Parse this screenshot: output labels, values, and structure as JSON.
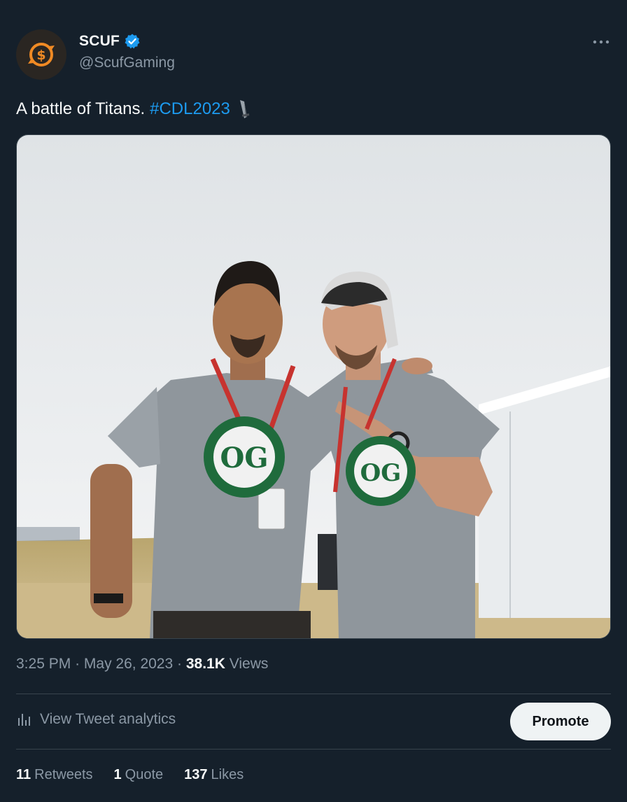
{
  "author": {
    "display_name": "SCUF",
    "handle": "@ScufGaming",
    "verified": true,
    "avatar_icon": "scuf-logo-icon",
    "avatar_color": "#f08a24"
  },
  "tweet": {
    "text": "A battle of Titans.",
    "hashtag": "#CDL2023",
    "emoji": "sword-emoji-icon",
    "media_alt": "Two smiling men in grey OpTic shirts with red lanyards posing outdoors in front of a white tent"
  },
  "meta": {
    "time": "3:25 PM",
    "date": "May 26, 2023",
    "sep1": "·",
    "sep2": "·",
    "views_count": "38.1K",
    "views_label": "Views"
  },
  "analytics": {
    "label": "View Tweet analytics",
    "icon": "analytics-bars-icon"
  },
  "promote_label": "Promote",
  "stats": {
    "retweets_count": "11",
    "retweets_label": "Retweets",
    "quotes_count": "1",
    "quotes_label": "Quote",
    "likes_count": "137",
    "likes_label": "Likes"
  },
  "colors": {
    "background": "#15202b",
    "link": "#1d9bf0",
    "secondary_text": "#8b98a5",
    "verified_badge": "#1d9bf0"
  }
}
